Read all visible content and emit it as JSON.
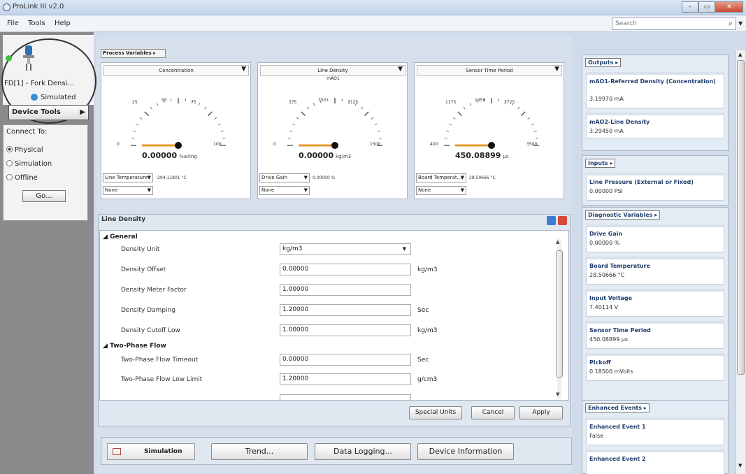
{
  "window": {
    "title": "ProLink III v2.0",
    "min": "–",
    "max": "▭",
    "close": "✕"
  },
  "menu": {
    "file": "File",
    "tools": "Tools",
    "help": "Help",
    "search_placeholder": "Search"
  },
  "device": {
    "name": "FD[1] - Fork Densi...",
    "mode": "Simulated",
    "tools_label": "Device Tools"
  },
  "connect": {
    "label": "Connect To:",
    "options": [
      "Physical",
      "Simulation",
      "Offline"
    ],
    "go": "Go..."
  },
  "process_variables": {
    "button": "Process Variables ▸",
    "gauges": [
      {
        "title": "Concentration",
        "sub": "",
        "value": "0.00000",
        "unit": "%ailing",
        "ticks": [
          "25",
          "50",
          "75",
          "100",
          "0"
        ],
        "side_select": "Line Temperature",
        "side_value": "-294.11801 °C",
        "bottom_select": "None"
      },
      {
        "title": "Line Density",
        "sub": "mAO1",
        "value": "0.00000",
        "unit": "kg/m3",
        "ticks": [
          "375",
          "750",
          "1125",
          "1500",
          "0"
        ],
        "side_select": "Drive Gain",
        "side_value": "0.00000 %",
        "bottom_select": "None"
      },
      {
        "title": "Sensor Time Period",
        "sub": "",
        "value": "450.08899",
        "unit": "µs",
        "ticks": [
          "1175",
          "1950",
          "2725",
          "3500",
          "400"
        ],
        "side_select": "Board Temperat...",
        "side_value": "28.50666 °C",
        "bottom_select": "None"
      }
    ]
  },
  "line_density": {
    "title": "Line Density",
    "sections": [
      {
        "name": "General",
        "props": [
          {
            "label": "Density Unit",
            "value": "kg/m3",
            "unit": ""
          },
          {
            "label": "Density Offset",
            "value": "0.00000",
            "unit": "kg/m3"
          },
          {
            "label": "Density Meter Factor",
            "value": "1.00000",
            "unit": ""
          },
          {
            "label": "Density Damping",
            "value": "1.20000",
            "unit": "Sec"
          },
          {
            "label": "Density Cutoff Low",
            "value": "1.00000",
            "unit": "kg/m3"
          }
        ]
      },
      {
        "name": "Two-Phase Flow",
        "props": [
          {
            "label": "Two-Phase Flow Timeout",
            "value": "0.00000",
            "unit": "Sec"
          },
          {
            "label": "Two-Phase Flow Low Limit",
            "value": "1.20000",
            "unit": "g/cm3"
          }
        ]
      }
    ],
    "buttons": {
      "special": "Special Units",
      "cancel": "Cancel",
      "apply": "Apply"
    }
  },
  "bottom": {
    "simulation": "Simulation",
    "trend": "Trend...",
    "logging": "Data Logging...",
    "info": "Device Information"
  },
  "right": {
    "outputs": {
      "header": "Outputs ▸",
      "items": [
        {
          "name": "mAO1-Referred Density (Concentration)",
          "value": "3.19970  mA"
        },
        {
          "name": "mAO2-Line Density",
          "value": "3.29450  mA"
        }
      ]
    },
    "inputs": {
      "header": "Inputs ▸",
      "items": [
        {
          "name": "Line Pressure (External or Fixed)",
          "value": "0.00000  PSI"
        }
      ]
    },
    "diag": {
      "header": "Diagnostic Variables ▸",
      "items": [
        {
          "name": "Drive Gain",
          "value": "0.00000  %"
        },
        {
          "name": "Board Temperature",
          "value": "28.50666  °C"
        },
        {
          "name": "Input Voltage",
          "value": "7.40114  V"
        },
        {
          "name": "Sensor Time Period",
          "value": "450.08899  µs"
        },
        {
          "name": "Pickoff",
          "value": "0.18500  mVolts"
        }
      ]
    },
    "events": {
      "header": "Enhanced Events ▸",
      "items": [
        {
          "name": "Enhanced Event 1",
          "value": "False"
        },
        {
          "name": "Enhanced Event 2",
          "value": ""
        }
      ]
    }
  }
}
